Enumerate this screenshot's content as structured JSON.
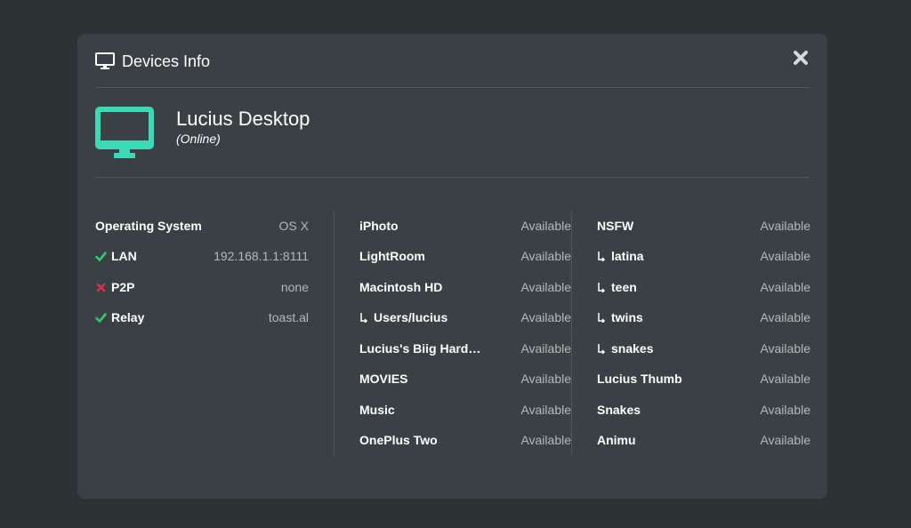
{
  "header": {
    "title": "Devices Info",
    "icon": "monitor-icon",
    "close_icon": "close-icon"
  },
  "device": {
    "name": "Lucius Desktop",
    "status": "(Online)",
    "icon_color": "#3dd9b6"
  },
  "info": {
    "rows": [
      {
        "label": "Operating System",
        "value": "OS X",
        "status": ""
      },
      {
        "label": "LAN",
        "value": "192.168.1.1:8111",
        "status": "ok"
      },
      {
        "label": "P2P",
        "value": "none",
        "status": "fail"
      },
      {
        "label": "Relay",
        "value": "toast.al",
        "status": "ok"
      }
    ]
  },
  "folders_1": {
    "rows": [
      {
        "label": "iPhoto",
        "value": "Available"
      },
      {
        "label": "LightRoom",
        "value": "Available"
      },
      {
        "label": "Macintosh HD",
        "value": "Available"
      },
      {
        "label": "Users/lucius",
        "value": "Available"
      },
      {
        "label": "Lucius's Biig Hard Drive",
        "value": "Available"
      },
      {
        "label": "MOVIES",
        "value": "Available"
      },
      {
        "label": "Music",
        "value": "Available"
      },
      {
        "label": "OnePlus Two",
        "value": "Available"
      }
    ]
  },
  "folders_2": {
    "rows": [
      {
        "label": "NSFW",
        "value": "Available"
      },
      {
        "label": "latina",
        "value": "Available"
      },
      {
        "label": "teen",
        "value": "Available"
      },
      {
        "label": "twins",
        "value": "Available"
      },
      {
        "label": "snakes",
        "value": "Available"
      },
      {
        "label": "Lucius Thumb",
        "value": "Available"
      },
      {
        "label": "Snakes",
        "value": "Available"
      },
      {
        "label": "Animu",
        "value": "Available"
      }
    ]
  },
  "colors": {
    "ok": "#2ecc71",
    "fail": "#e8274b",
    "accent": "#3dd9b6"
  }
}
